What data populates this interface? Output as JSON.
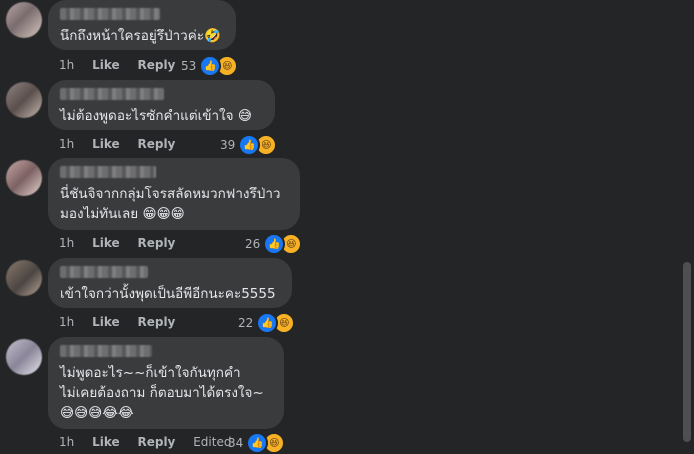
{
  "comments": [
    {
      "text": "นึกถึงหน้าใครอยู่รึป่าวค่ะ🤣",
      "time": "1h",
      "like": "Like",
      "reply": "Reply",
      "edited": "",
      "count": "53"
    },
    {
      "text": "ไม่ต้องพูดอะไรซักคำแต่เข้าใจ 😅",
      "time": "1h",
      "like": "Like",
      "reply": "Reply",
      "edited": "",
      "count": "39"
    },
    {
      "text": "นี่ชันจิจากกลุ่มโจรสลัดหมวกฟางรึป่าว\nมองไม่ทันเลย 😁😁😁",
      "time": "1h",
      "like": "Like",
      "reply": "Reply",
      "edited": "",
      "count": "26"
    },
    {
      "text": "เข้าใจกว่านั้งพุดเป็นอีพีอีกนะคะ5555",
      "time": "1h",
      "like": "Like",
      "reply": "Reply",
      "edited": "",
      "count": "22"
    },
    {
      "text": "ไม่พูดอะไร~~ก็เข้าใจกันทุกคำ\nไม่เคยต้องถาม ก็ตอบมาได้ตรงใจ~\n😅😅😅😂😂",
      "time": "1h",
      "like": "Like",
      "reply": "Reply",
      "edited": "Edited",
      "count": "34"
    }
  ],
  "icons": {
    "like": "thumbs-up-icon",
    "haha": "laughing-face-icon"
  },
  "colors": {
    "background": "#242526",
    "bubble": "#3a3b3c",
    "like": "#1877f2",
    "haha": "#f7b125"
  }
}
